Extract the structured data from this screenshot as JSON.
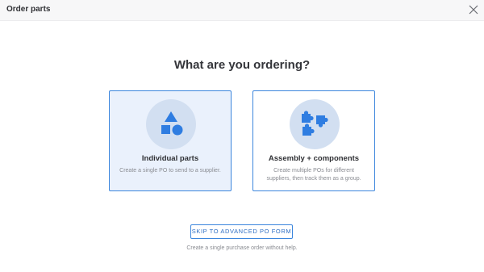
{
  "header": {
    "title": "Order parts",
    "close_icon": "close-icon"
  },
  "question": "What are you ordering?",
  "options": [
    {
      "title": "Individual parts",
      "description": "Create a single PO to send to a supplier.",
      "icon": "shapes-icon",
      "selected": true
    },
    {
      "title": "Assembly + components",
      "description": "Create multiple POs for different suppliers, then track them as a group.",
      "icon": "puzzle-pieces-icon",
      "selected": false
    }
  ],
  "skip": {
    "label": "SKIP TO ADVANCED PO FORM",
    "help_text": "Create a single purchase order without help."
  },
  "colors": {
    "accent": "#3c86dd",
    "selected_bg": "#eaf1fc",
    "icon_circle": "#d2dff1",
    "icon_blue": "#2f7de1"
  }
}
